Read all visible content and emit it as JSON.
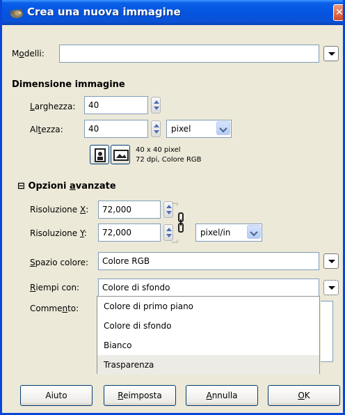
{
  "window": {
    "title": "Crea una nuova immagine",
    "close_glyph": "✕"
  },
  "templates": {
    "label_pre": "M",
    "label_ul": "o",
    "label_post": "delli:",
    "value": ""
  },
  "image_size": {
    "heading": "Dimensione immagine",
    "width_label_pre": "",
    "width_label_ul": "L",
    "width_label_post": "arghezza:",
    "width_value": "40",
    "height_label_pre": "Al",
    "height_label_ul": "t",
    "height_label_post": "ezza:",
    "height_value": "40",
    "unit": "pixel",
    "portrait_icon": "portrait-icon",
    "landscape_icon": "landscape-icon",
    "info_line1": "40 x 40 pixel",
    "info_line2": "72 dpi, Colore RGB"
  },
  "advanced": {
    "heading_toggle": "⊟",
    "heading_pre": "Opzioni ",
    "heading_ul": "a",
    "heading_post": "vanzate",
    "res_x_label_pre": "Risoluzione ",
    "res_x_label_ul": "X",
    "res_x_label_post": ":",
    "res_x_value": "72,000",
    "res_y_label_pre": "Risoluzione ",
    "res_y_label_ul": "Y",
    "res_y_label_post": ":",
    "res_y_value": "72,000",
    "res_unit": "pixel/in",
    "color_space_label_pre": "",
    "color_space_label_ul": "S",
    "color_space_label_post": "pazio colore:",
    "color_space_value": "Colore RGB",
    "fill_label_pre": "",
    "fill_label_ul": "R",
    "fill_label_post": "iempi con:",
    "fill_value": "Colore di sfondo",
    "comment_label_pre": "Comme",
    "comment_label_ul": "n",
    "comment_label_post": "to:"
  },
  "fill_options": [
    {
      "label": "Colore di primo piano"
    },
    {
      "label": "Colore di sfondo"
    },
    {
      "label": "Bianco"
    },
    {
      "label": "Trasparenza"
    }
  ],
  "buttons": {
    "help": "Aiuto",
    "reset_ul": "R",
    "reset_post": "eimposta",
    "cancel_ul": "A",
    "cancel_post": "nnulla",
    "ok_ul": "O",
    "ok_post": "K"
  },
  "colors": {
    "titlebar": "#0454e0",
    "dialog_bg": "#ece9d8",
    "field_border": "#7f9db9",
    "highlight": "#ecebe6"
  }
}
